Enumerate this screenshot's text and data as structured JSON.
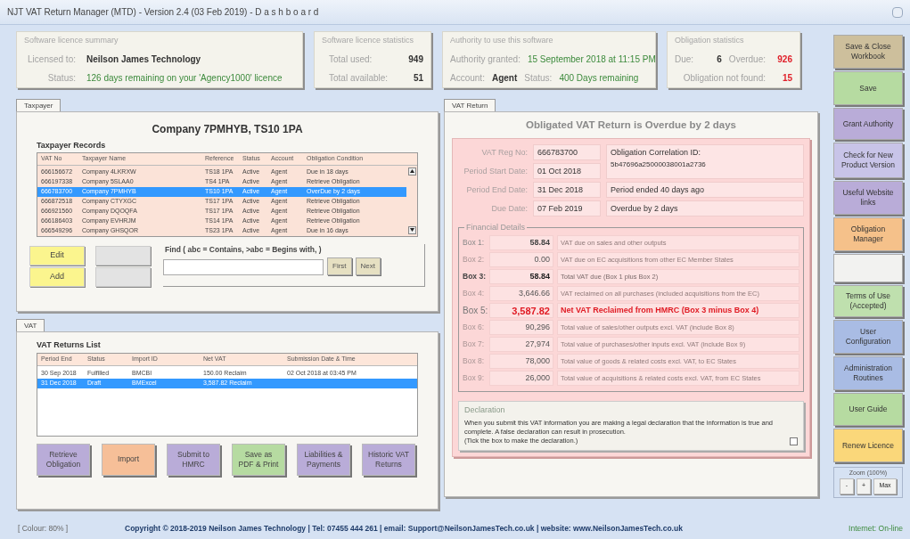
{
  "window": {
    "title": "NJT VAT Return Manager (MTD) - Version 2.4 (03 Feb 2019) -  D a s h b o a r d"
  },
  "license_summary": {
    "title": "Software licence summary",
    "rows": [
      {
        "label": "Licensed to:",
        "value": "Neilson James Technology",
        "kind": "dark"
      },
      {
        "label": "Status:",
        "value": "126 days remaining on your 'Agency1000' licence",
        "kind": "green"
      }
    ]
  },
  "license_stats": {
    "title": "Software licence statistics",
    "rows": [
      {
        "label": "Total used:",
        "value": "949"
      },
      {
        "label": "Total available:",
        "value": "51"
      }
    ]
  },
  "authority": {
    "title": "Authority to use this software",
    "granted_label": "Authority granted:",
    "granted": "15 September 2018 at 11:15 PM",
    "account_label": "Account:",
    "account": "Agent",
    "status_label": "Status:",
    "status": "400 Days remaining"
  },
  "obligation_stats": {
    "title": "Obligation statistics",
    "due_label": "Due:",
    "due": "6",
    "overdue_label": "Overdue:",
    "overdue": "926",
    "not_found_label": "Obligation not found:",
    "not_found": "15"
  },
  "taxpayer": {
    "tab": {
      "label": "Taxpayer",
      "selected": true
    },
    "heading": "Company 7PMHYB, TS10 1PA",
    "records_title": "Taxpayer Records",
    "columns": [
      "VAT No",
      "Taxpayer Name",
      "Reference",
      "Status",
      "Account",
      "Obligation Condition"
    ],
    "rows": [
      {
        "cells": [
          "666156672",
          "Company 4LKRXW",
          "TS18 1PA",
          "Active",
          "Agent",
          "Due in 18 days"
        ],
        "selected": false
      },
      {
        "cells": [
          "666197338",
          "Company 5SLAA0",
          "TS4 1PA",
          "Active",
          "Agent",
          "Retrieve Obligation"
        ],
        "selected": false
      },
      {
        "cells": [
          "666783700",
          "Company 7PMHYB",
          "TS10 1PA",
          "Active",
          "Agent",
          "OverDue by 2 days"
        ],
        "selected": true
      },
      {
        "cells": [
          "666872518",
          "Company CTYXGC",
          "TS17 1PA",
          "Active",
          "Agent",
          "Retrieve Obligation"
        ],
        "selected": false
      },
      {
        "cells": [
          "666921560",
          "Company DQOQFA",
          "TS17 1PA",
          "Active",
          "Agent",
          "Retrieve Obligation"
        ],
        "selected": false
      },
      {
        "cells": [
          "666186403",
          "Company EVHRJM",
          "TS14 1PA",
          "Active",
          "Agent",
          "Retrieve Obligation"
        ],
        "selected": false
      },
      {
        "cells": [
          "666549296",
          "Company GHSQOR",
          "TS23 1PA",
          "Active",
          "Agent",
          "Due in 16 days"
        ],
        "selected": false
      }
    ],
    "buttons": [
      {
        "kind": "yellow",
        "label": "Edit"
      },
      {
        "kind": "blank"
      },
      {
        "kind": "yellow",
        "label": "Add"
      },
      {
        "kind": "blank"
      }
    ],
    "find_label": "Find ( abc = Contains,  >abc = Begins with, )",
    "find_buttons": [
      "First",
      "Next"
    ]
  },
  "vat": {
    "tab": {
      "label": "VAT",
      "selected": true
    },
    "list_title": "VAT Returns List",
    "columns": [
      "Period End",
      "Status",
      "Import ID",
      "Net VAT",
      "Submission Date & Time"
    ],
    "rows": [
      {
        "cells": [
          "30 Sep 2018",
          "Fulfilled",
          "BMCBI",
          "150.00 Reclaim",
          "02 Oct 2018 at 03:45 PM"
        ],
        "selected": false
      },
      {
        "cells": [
          "31 Dec 2018",
          "Draft",
          "BMExcel",
          "3,587.82 Reclaim"
        ],
        "selected": true
      }
    ],
    "buttons": [
      {
        "label": "Retrieve Obligation",
        "color": "#b9acd8"
      },
      {
        "label": "Import",
        "color": "#f6bf98"
      },
      {
        "label": "Submit to HMRC",
        "color": "#b9acd8"
      },
      {
        "label": "Save as PDF & Print",
        "color": "#b6dba1"
      },
      {
        "label": "Liabilities & Payments",
        "color": "#b9acd8"
      },
      {
        "label": "Historic VAT Returns",
        "color": "#b9acd8"
      }
    ]
  },
  "vat_return": {
    "tab": {
      "label": "VAT Return",
      "selected": true
    },
    "heading": "Obligated VAT Return is Overdue by 2 days",
    "fields": [
      {
        "label": "VAT Reg No:",
        "value": "666783700"
      },
      {
        "label": "Period Start Date:",
        "value": "01 Oct 2018"
      },
      {
        "label": "Period End Date:",
        "value": "31 Dec 2018"
      },
      {
        "label": "Due Date:",
        "value": "07 Feb 2019"
      }
    ],
    "correlation_label": "Obligation Correlation ID:",
    "correlation_id": "5b47696a25000038001a2736",
    "period_note": "Period ended 40 days ago",
    "due_note": "Overdue by 2 days",
    "financial_title": "Financial Details",
    "boxes": [
      {
        "label": "Box 1:",
        "value": "58.84",
        "description": "VAT due on sales and other outputs",
        "kind": "normal"
      },
      {
        "label": "Box 2:",
        "value": "0.00",
        "description": "VAT due on EC acquisitions from other EC Member States",
        "kind": "muted"
      },
      {
        "label": "Box 3:",
        "value": "58.84",
        "description": "Total VAT due (Box 1 plus Box 2)",
        "kind": "total"
      },
      {
        "label": "Box 4:",
        "value": "3,646.66",
        "description": "VAT reclaimed on all purchases (included acquisitions from the EC)",
        "kind": "muted"
      },
      {
        "label": "Box 5:",
        "value": "3,587.82",
        "description": "Net VAT Reclaimed from HMRC (Box 3 minus Box 4)",
        "kind": "net"
      },
      {
        "label": "Box 6:",
        "value": "90,296",
        "description": "Total value of sales/other outputs excl. VAT (include Box 8)",
        "kind": "muted"
      },
      {
        "label": "Box 7:",
        "value": "27,974",
        "description": "Total value of purchases/other inputs excl. VAT (include Box 9)",
        "kind": "muted"
      },
      {
        "label": "Box 8:",
        "value": "78,000",
        "description": "Total value of goods & related costs excl. VAT, to EC States",
        "kind": "muted"
      },
      {
        "label": "Box 9:",
        "value": "26,000",
        "description": "Total value of acquisitions & related costs excl. VAT, from EC States",
        "kind": "muted"
      }
    ],
    "declaration": {
      "title": "Declaration",
      "text": "When you submit this VAT information you are making a legal declaration that the information is true and complete. A false declaration can result in prosecution.",
      "hint": "(Tick the box to make the declaration.)",
      "checked": false
    }
  },
  "sidebar": [
    {
      "label": "Save & Close Workbook",
      "color": "#cdbf9c"
    },
    {
      "label": "Save",
      "color": "#b6dba1"
    },
    {
      "label": "Grant Authority",
      "color": "#b9acd8"
    },
    {
      "label": "Check for New Product Version",
      "color": "#c8c4e8"
    },
    {
      "label": "Useful Website links",
      "color": "#b9acd8"
    },
    {
      "label": "Obligation Manager",
      "color": "#f5c18a"
    },
    {
      "color": "#f2f2f0"
    },
    {
      "label": "Terms of Use (Accepted)",
      "color": "#bfe0ae"
    },
    {
      "label": "User Configuration",
      "color": "#a9bce4"
    },
    {
      "label": "Administration Routines",
      "color": "#a9bce4"
    },
    {
      "label": "User Guide",
      "color": "#b6dba1"
    },
    {
      "label": "Renew Licence",
      "color": "#fad77a"
    }
  ],
  "zoom": {
    "title": "Zoom (100%)",
    "buttons": [
      "-",
      "+",
      "Max"
    ]
  },
  "footer": {
    "colour": "[ Colour: 80% ]",
    "copyright": "Copyright © 2018-2019 Neilson James Technology  |  Tel: 07455 444 261  |  email: Support@NeilsonJamesTech.co.uk  |  website: www.NeilsonJamesTech.co.uk",
    "internet": "Internet: On-line"
  }
}
